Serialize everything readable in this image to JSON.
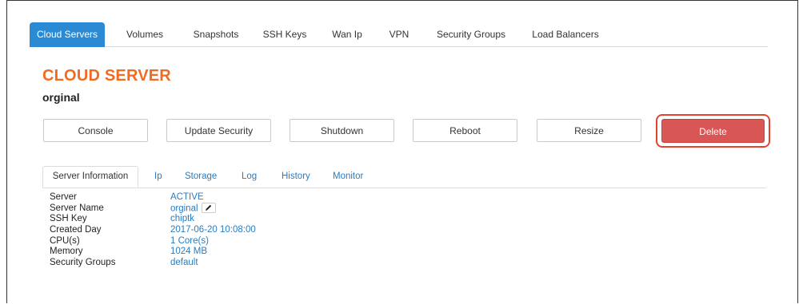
{
  "top_tabs": [
    {
      "label": "Cloud Servers",
      "active": true
    },
    {
      "label": "Volumes",
      "active": false
    },
    {
      "label": "Snapshots",
      "active": false
    },
    {
      "label": "SSH Keys",
      "active": false
    },
    {
      "label": "Wan Ip",
      "active": false
    },
    {
      "label": "VPN",
      "active": false
    },
    {
      "label": "Security Groups",
      "active": false
    },
    {
      "label": "Load Balancers",
      "active": false
    }
  ],
  "header": {
    "title": "CLOUD SERVER",
    "server_name": "orginal"
  },
  "actions": {
    "console": "Console",
    "update_security": "Update Security",
    "shutdown": "Shutdown",
    "reboot": "Reboot",
    "resize": "Resize",
    "delete": "Delete"
  },
  "sub_tabs": [
    {
      "label": "Server Information",
      "active": true
    },
    {
      "label": "Ip",
      "active": false
    },
    {
      "label": "Storage",
      "active": false
    },
    {
      "label": "Log",
      "active": false
    },
    {
      "label": "History",
      "active": false
    },
    {
      "label": "Monitor",
      "active": false
    }
  ],
  "server_info": [
    {
      "label": "Server",
      "value": "ACTIVE"
    },
    {
      "label": "Server Name",
      "value": "orginal"
    },
    {
      "label": "SSH Key",
      "value": "chiptk"
    },
    {
      "label": "Created Day",
      "value": "2017-06-20 10:08:00"
    },
    {
      "label": "CPU(s)",
      "value": "1 Core(s)"
    },
    {
      "label": "Memory",
      "value": "1024 MB"
    },
    {
      "label": "Security Groups",
      "value": "default"
    }
  ],
  "colors": {
    "accent_blue": "#2a8ad4",
    "title_orange": "#f16b22",
    "delete_red": "#d85654",
    "highlight_red": "#e5422e",
    "link_blue": "#2a7bbf"
  },
  "icons": {
    "edit": "pencil-icon"
  }
}
